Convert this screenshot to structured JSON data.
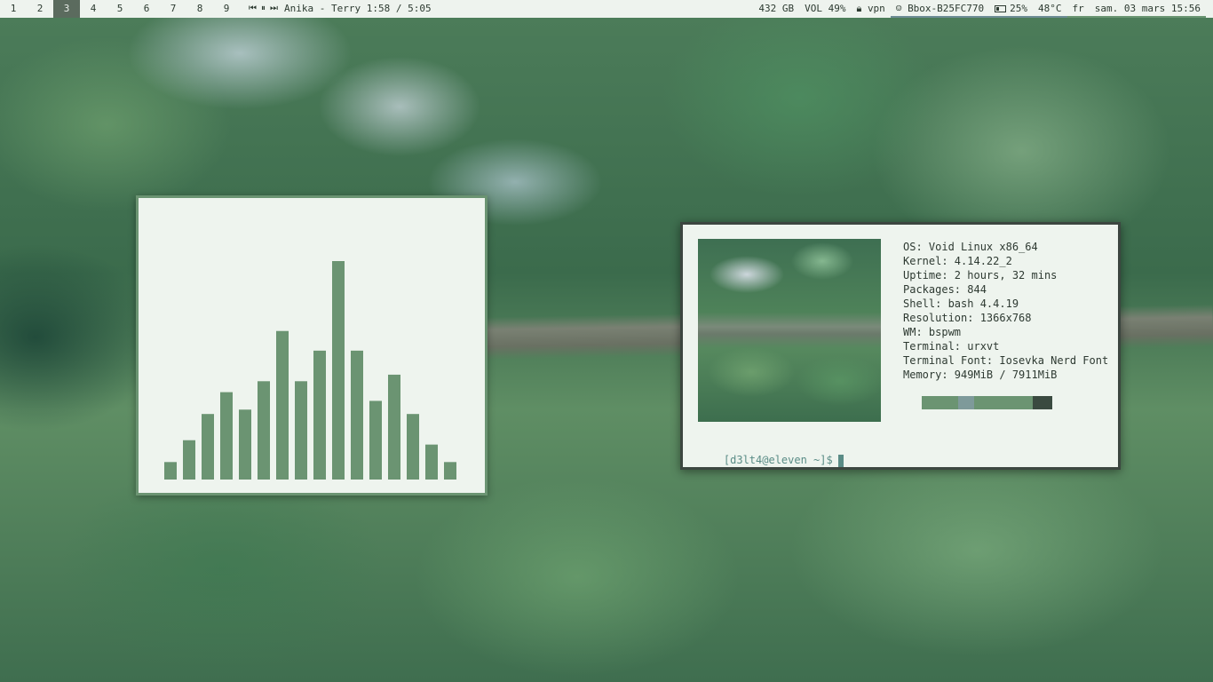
{
  "topbar": {
    "workspaces": [
      "1",
      "2",
      "3",
      "4",
      "5",
      "6",
      "7",
      "8",
      "9"
    ],
    "active_workspace": "3",
    "media": {
      "prev_icon": "⏮",
      "pause_icon": "⏸",
      "next_icon": "⏭",
      "track": "Anika - Terry 1:58 / 5:05"
    },
    "disk": "432 GB",
    "volume": "VOL 49%",
    "vpn": "vpn",
    "wifi": "Bbox-B25FC770",
    "battery": "25%",
    "temperature": "48°C",
    "keyboard_layout": "fr",
    "datetime": "sam. 03 mars 15:56"
  },
  "visualizer": {
    "bar_color": "#6b9472",
    "bars": [
      0.08,
      0.18,
      0.3,
      0.4,
      0.32,
      0.45,
      0.68,
      0.45,
      0.59,
      1.0,
      0.59,
      0.36,
      0.48,
      0.3,
      0.16,
      0.08
    ]
  },
  "neofetch": {
    "lines": [
      "OS: Void Linux x86_64",
      "Kernel: 4.14.22_2",
      "Uptime: 2 hours, 32 mins",
      "Packages: 844",
      "Shell: bash 4.4.19",
      "Resolution: 1366x768",
      "WM: bspwm",
      "Terminal: urxvt",
      "Terminal Font: Iosevka Nerd Font",
      "Memory: 949MiB / 7911MiB"
    ],
    "palette": [
      {
        "color": "#6b9472",
        "share": 0.28
      },
      {
        "color": "#7e9a9a",
        "share": 0.12
      },
      {
        "color": "#6b9472",
        "share": 0.45
      },
      {
        "color": "#3a4a40",
        "share": 0.15
      }
    ],
    "prompt": "[d3lt4@eleven ~]$"
  },
  "colors": {
    "bar_bg": "#eef3ee",
    "accent": "#6b9472",
    "window_bg": "#eef4ee"
  }
}
